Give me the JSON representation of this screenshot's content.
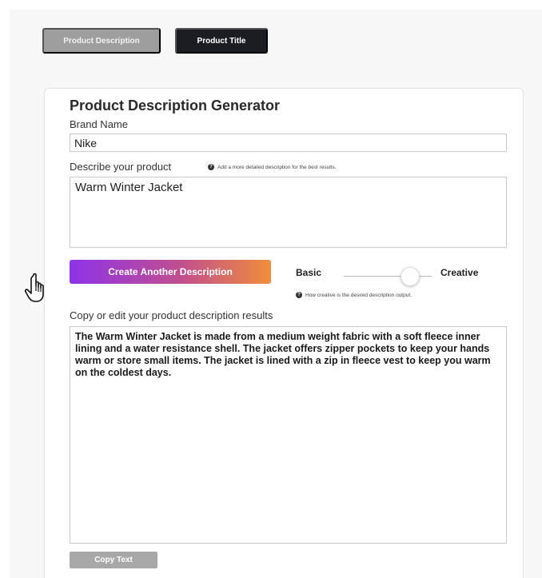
{
  "tabs": {
    "description_label": "Product Description",
    "title_label": "Product Title"
  },
  "generator": {
    "heading": "Product Description Generator",
    "brand_label": "Brand Name",
    "brand_value": "Nike",
    "describe_label": "Describe your product",
    "describe_hint": "Add a more detailed description for the best results.",
    "describe_value": "Warm Winter Jacket",
    "generate_button": "Create Another Description",
    "slider": {
      "min_label": "Basic",
      "max_label": "Creative",
      "hint": "How creative is the desired description output.",
      "level": 0.75
    },
    "results_label": "Copy or edit your product description results",
    "results_value": "The Warm Winter Jacket is made from a medium weight fabric with a soft fleece inner lining and a water resistance shell. The jacket offers zipper pockets to keep your hands warm or store small items. The jacket is lined with a zip in fleece vest to keep you warm on the coldest days.",
    "copy_button": "Copy Text"
  },
  "icons": {
    "help": "question-circle-icon",
    "pointer": "hand-pointer-icon"
  },
  "colors": {
    "active_tab": "#1c1d22",
    "inactive_tab": "#9e9e9e",
    "gradient_start": "#8d33e8",
    "gradient_end": "#f08d3b"
  }
}
